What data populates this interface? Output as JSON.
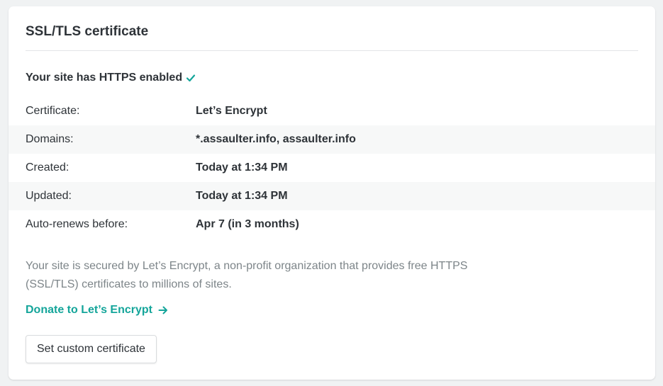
{
  "card": {
    "title": "SSL/TLS certificate"
  },
  "status": {
    "text": "Your site has HTTPS enabled",
    "icon": "check-icon",
    "icon_color": "#14a59a"
  },
  "details": [
    {
      "label": "Certificate:",
      "value": "Let’s Encrypt"
    },
    {
      "label": "Domains:",
      "value": "*.assaulter.info, assaulter.info"
    },
    {
      "label": "Created:",
      "value": "Today at 1:34 PM"
    },
    {
      "label": "Updated:",
      "value": "Today at 1:34 PM"
    },
    {
      "label": "Auto-renews before:",
      "value": "Apr 7 (in 3 months)"
    }
  ],
  "description": "Your site is secured by Let’s Encrypt, a non-profit organization that provides free HTTPS (SSL/TLS) certificates to millions of sites.",
  "donate_link": {
    "label": "Donate to Let’s Encrypt",
    "icon": "arrow-right-icon",
    "color": "#14a59a"
  },
  "custom_button": {
    "label": "Set custom certificate"
  }
}
